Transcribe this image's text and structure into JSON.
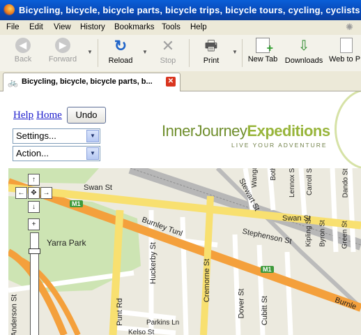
{
  "window": {
    "title": "Bicycling, bicycle, bicycle parts, bicycle trips, bicycle tours, cycling, cyclists - "
  },
  "menu": [
    "File",
    "Edit",
    "View",
    "History",
    "Bookmarks",
    "Tools",
    "Help"
  ],
  "toolbar": {
    "back": "Back",
    "forward": "Forward",
    "reload": "Reload",
    "stop": "Stop",
    "print": "Print",
    "new_tab": "New Tab",
    "downloads": "Downloads",
    "web_to": "Web to P"
  },
  "tab": {
    "label": "Bicycling, bicycle, bicycle parts, b..."
  },
  "page": {
    "help": "Help",
    "home": "Home",
    "undo": "Undo",
    "settings": "Settings...",
    "action": "Action...",
    "logo_part1": "InnerJourney",
    "logo_part2": "Expeditions",
    "logo_tag": "LIVE YOUR ADVENTURE"
  },
  "map": {
    "labels": {
      "swan1": "Swan St",
      "swan2": "Swan St",
      "burnley1": "Burnley Tunl",
      "burnley2": "Burnle",
      "yarra": "Yarra Park",
      "stewart": "Stewart St",
      "stephenson": "Stephenson St",
      "huckerby": "Huckerby St",
      "cremorne": "Cremorne St",
      "punt": "Punt Rd",
      "dover": "Dover St",
      "cubitt": "Cubitt St",
      "parkins": "Parkins Ln",
      "kelso": "Kelso St",
      "anderson": "Anderson St",
      "wangar": "Wangar",
      "both": "Both",
      "lennox": "Lennox St",
      "carroll": "Carroll S",
      "dando": "Dando St",
      "kipling": "Kipling St",
      "byron": "Byron St",
      "green": "Green St"
    },
    "shield1": "M1",
    "shield2": "M1"
  }
}
